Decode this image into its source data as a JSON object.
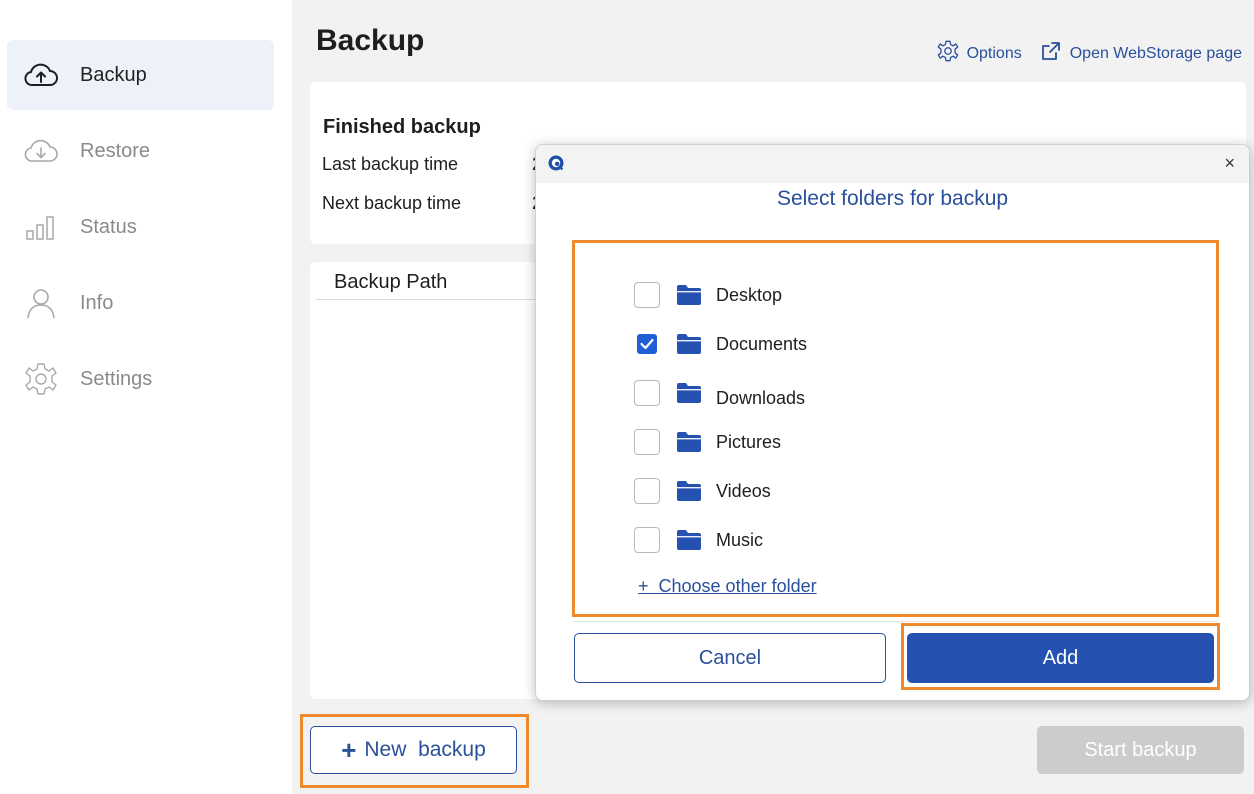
{
  "sidebar": {
    "items": [
      {
        "label": "Backup",
        "icon": "cloud-upload-icon",
        "active": true
      },
      {
        "label": "Restore",
        "icon": "cloud-download-icon",
        "active": false
      },
      {
        "label": "Status",
        "icon": "bar-chart-icon",
        "active": false
      },
      {
        "label": "Info",
        "icon": "person-icon",
        "active": false
      },
      {
        "label": "Settings",
        "icon": "gear-icon",
        "active": false
      }
    ]
  },
  "header": {
    "title": "Backup",
    "options_label": "Options",
    "open_webstorage_label": "Open WebStorage page"
  },
  "summary": {
    "heading": "Finished backup",
    "last_backup_label": "Last backup time",
    "last_backup_value": "2",
    "next_backup_label": "Next backup time",
    "next_backup_value": "2"
  },
  "table": {
    "column_header": "Backup Path"
  },
  "footer": {
    "new_backup_plus": "+",
    "new_backup_label": "New  backup",
    "start_backup_label": "Start backup"
  },
  "dialog": {
    "close_glyph": "×",
    "heading": "Select folders for backup",
    "folders": [
      {
        "name": "Desktop",
        "checked": false
      },
      {
        "name": "Documents",
        "checked": true
      },
      {
        "name": "Downloads",
        "checked": false
      },
      {
        "name": "Pictures",
        "checked": false
      },
      {
        "name": "Videos",
        "checked": false
      },
      {
        "name": "Music",
        "checked": false
      }
    ],
    "choose_other_label": "+  Choose other folder",
    "cancel_label": "Cancel",
    "add_label": "Add"
  },
  "colors": {
    "accent": "#2551b1",
    "link": "#2a4f9b",
    "highlight": "#f08a2c",
    "folder": "#2551b1",
    "checkbox_checked": "#1f5fd6"
  }
}
